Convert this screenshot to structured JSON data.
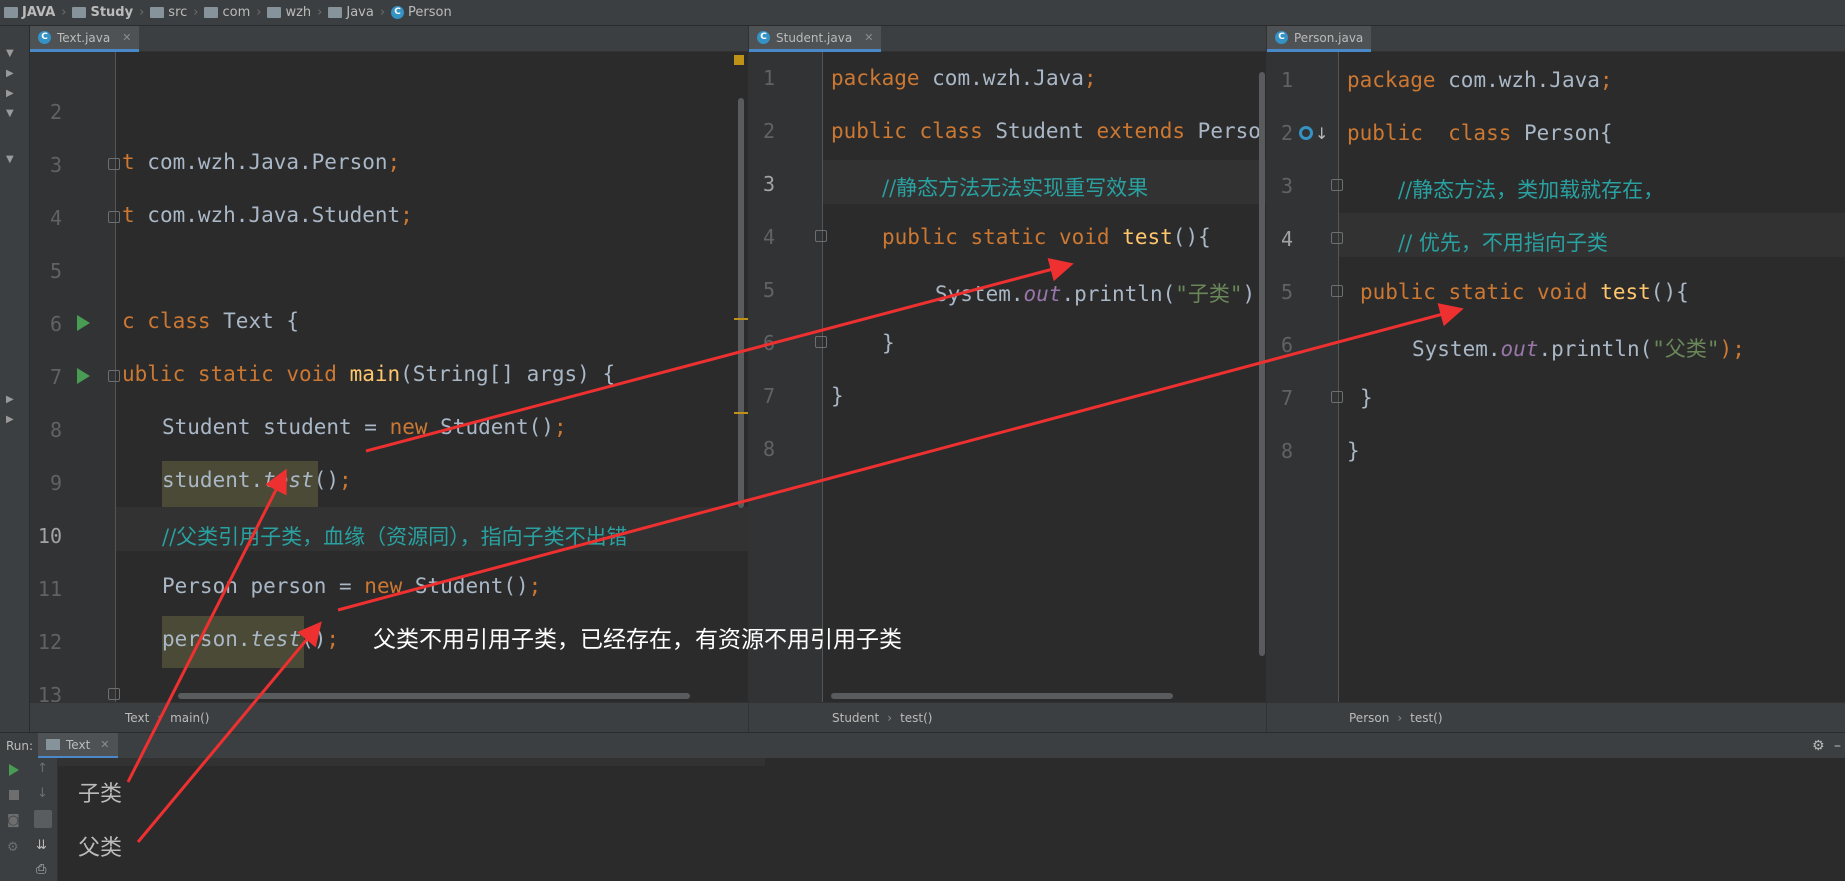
{
  "breadcrumb": [
    "JAVA",
    "Study",
    "src",
    "com",
    "wzh",
    "Java",
    "Person"
  ],
  "left_pane": {
    "tab": "Text.java",
    "line_numbers": [
      "2",
      "3",
      "4",
      "5",
      "6",
      "7",
      "8",
      "9",
      "10",
      "11",
      "12",
      "13"
    ],
    "line3": {
      "a": "t ",
      "b": "com.wzh.Java.Person",
      "c": ";"
    },
    "line4": {
      "a": "t ",
      "b": "com.wzh.Java.Student",
      "c": ";"
    },
    "line6": {
      "a": "c ",
      "b": "class",
      "c": " Text {"
    },
    "line7": {
      "a": "ublic static void ",
      "b": "main",
      "c": "(String[] args) {"
    },
    "line8": {
      "a": "Student student = ",
      "b": "new",
      "c": " Student()",
      "d": ";"
    },
    "line9": {
      "a": "student.",
      "b": "test",
      "c": "()",
      "d": ";"
    },
    "line10": "//父类引用子类，血缘（资源同），指向子类不出错",
    "line11": {
      "a": "Person person = ",
      "b": "new",
      "c": " Student()",
      "d": ";"
    },
    "line12": {
      "a": "person.",
      "b": "test",
      "c": "()",
      "d": ";"
    },
    "footer": [
      "Text",
      "main()"
    ]
  },
  "middle_pane": {
    "tab": "Student.java",
    "line_numbers": [
      "1",
      "2",
      "3",
      "4",
      "5",
      "6",
      "7",
      "8"
    ],
    "line1": {
      "a": "package",
      "b": " com.wzh.Java",
      "c": ";"
    },
    "line2": {
      "a": "public class",
      "b": " Student ",
      "c": "extends",
      "d": " Perso"
    },
    "line3": "//静态方法无法实现重写效果",
    "line4": {
      "a": "public static void ",
      "b": "test",
      "c": "(){"
    },
    "line5": {
      "a": "System.",
      "b": "out",
      "c": ".println(",
      "d": "\"子类\"",
      "e": ")"
    },
    "line6": "}",
    "line7": "}",
    "footer": [
      "Student",
      "test()"
    ]
  },
  "right_pane": {
    "tab": "Person.java",
    "line_numbers": [
      "1",
      "2",
      "3",
      "4",
      "5",
      "6",
      "7",
      "8"
    ],
    "line1": {
      "a": "package",
      "b": " com.wzh.Java",
      "c": ";"
    },
    "line2": {
      "a": "public  class",
      "b": " Person{"
    },
    "line3": "//静态方法，类加载就存在，",
    "line4": "// 优先，不用指向子类",
    "line5": {
      "a": "public static void ",
      "b": "test",
      "c": "(){"
    },
    "line6": {
      "a": "System.",
      "b": "out",
      "c": ".println(",
      "d": "\"父类\"",
      "e": ");"
    },
    "line7": "}",
    "line8": "}",
    "footer": [
      "Person",
      "test()"
    ]
  },
  "run_panel": {
    "label": "Run:",
    "tab": "Text",
    "output": [
      "子类",
      "父类"
    ]
  },
  "annotation": "父类不用引用子类，已经存在，有资源不用引用子类",
  "colors": {
    "keyword": "#cc7832",
    "comment": "#2aa1a1",
    "string": "#6a8759",
    "function": "#ffc66d",
    "arrow": "#ee3030"
  }
}
